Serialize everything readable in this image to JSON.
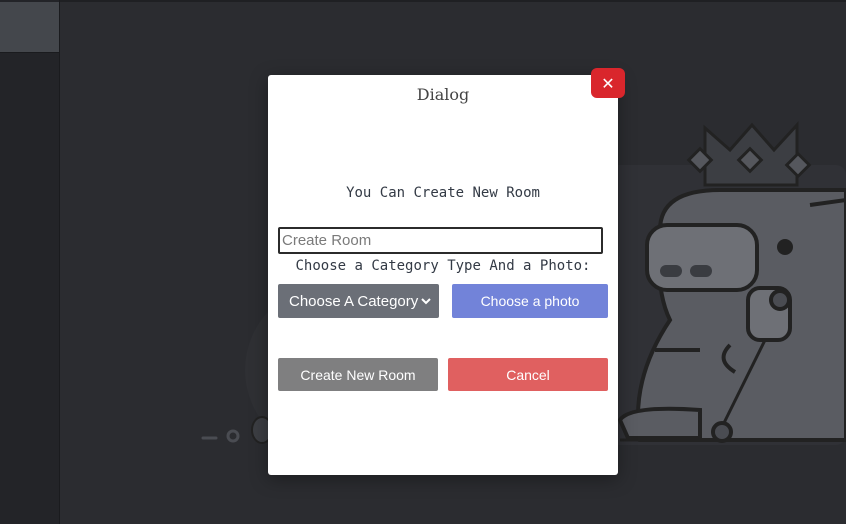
{
  "dialog": {
    "title": "Dialog",
    "close_icon": "close-icon",
    "close_symbol": "✕",
    "subtitle": "You Can Create New Room",
    "room_input": {
      "placeholder": "Create Room",
      "value": ""
    },
    "category_prompt": "Choose a Category Type And a Photo:",
    "category_select": {
      "selected": "Choose A Category",
      "icon": "chevron-down-icon"
    },
    "photo_button": "Choose a photo",
    "create_button": "Create New Room",
    "cancel_button": "Cancel"
  },
  "colors": {
    "background": "#2b2c30",
    "close": "#d9262c",
    "select": "#6b6f77",
    "photo": "#7283d9",
    "create": "#7f7f80",
    "cancel": "#e06060"
  }
}
